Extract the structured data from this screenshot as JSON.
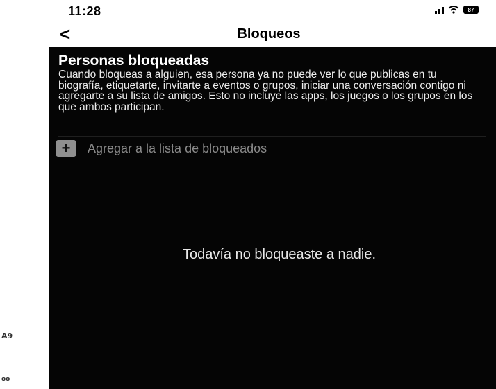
{
  "status_bar": {
    "time": "11:28",
    "battery_label": "87",
    "icons": [
      "signal-icon",
      "wifi-icon",
      "battery-icon"
    ]
  },
  "nav": {
    "back_glyph": "<",
    "title": "Bloqueos"
  },
  "section": {
    "title": "Personas bloqueadas",
    "description": "Cuando bloqueas a alguien, esa persona ya no puede ver lo que publicas en tu biografía, etiquetarte, invitarte a eventos o grupos, iniciar una conversación contigo ni agregarte a su lista de amigos. Esto no incluye las apps, los juegos o los grupos en los que ambos participan."
  },
  "add_blocked": {
    "icon": "plus-icon",
    "label": "Agregar a la lista de bloqueados"
  },
  "empty_state": {
    "message": "Todavía no bloqueaste a nadie."
  },
  "side_fragments": {
    "top": "A9",
    "bottom": "oo"
  },
  "colors": {
    "content_background": "#050505",
    "add_label": "#8a8a8a",
    "plus_icon_bg": "#8f8f8f"
  }
}
